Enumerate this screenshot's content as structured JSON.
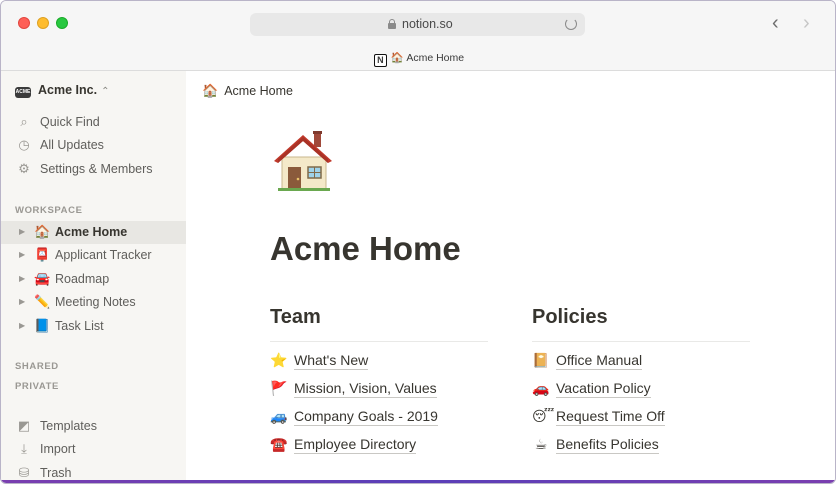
{
  "browser": {
    "url": "notion.so",
    "tab_title": "Acme Home",
    "tab_icon": "N",
    "tab_emoji": "🏠"
  },
  "sidebar": {
    "workspace_name": "Acme Inc.",
    "workspace_logo": "ACME",
    "workspace_chevron": "⌃",
    "top_items": [
      {
        "label": "Quick Find",
        "icon": "search-icon",
        "glyph": "⌕"
      },
      {
        "label": "All Updates",
        "icon": "clock-icon",
        "glyph": "◷"
      },
      {
        "label": "Settings & Members",
        "icon": "gear-icon",
        "glyph": "⚙"
      }
    ],
    "workspace_heading": "WORKSPACE",
    "pages": [
      {
        "label": "Acme Home",
        "emoji": "🏠",
        "active": true
      },
      {
        "label": "Applicant Tracker",
        "emoji": "📮",
        "active": false
      },
      {
        "label": "Roadmap",
        "emoji": "🚘",
        "active": false
      },
      {
        "label": "Meeting Notes",
        "emoji": "✏️",
        "active": false
      },
      {
        "label": "Task List",
        "emoji": "📘",
        "active": false
      }
    ],
    "shared_heading": "SHARED",
    "private_heading": "PRIVATE",
    "bottom_items": [
      {
        "label": "Templates",
        "icon": "templates-icon",
        "glyph": "◩"
      },
      {
        "label": "Import",
        "icon": "download-icon",
        "glyph": "⤓"
      },
      {
        "label": "Trash",
        "icon": "trash-icon",
        "glyph": "⛁"
      }
    ]
  },
  "main": {
    "breadcrumb": {
      "emoji": "🏠",
      "label": "Acme Home"
    },
    "page_icon": "house-icon",
    "title": "Acme Home",
    "columns": [
      {
        "title": "Team",
        "links": [
          {
            "emoji": "⭐",
            "label": "What's New"
          },
          {
            "emoji": "🚩",
            "label": "Mission, Vision, Values"
          },
          {
            "emoji": "🚙",
            "label": "Company Goals - 2019"
          },
          {
            "emoji": "☎️",
            "label": "Employee Directory"
          }
        ]
      },
      {
        "title": "Policies",
        "links": [
          {
            "emoji": "📔",
            "label": "Office Manual"
          },
          {
            "emoji": "🚗",
            "label": "Vacation Policy"
          },
          {
            "emoji": "😴",
            "label": "Request Time Off"
          },
          {
            "emoji": "☕",
            "label": "Benefits Policies"
          }
        ]
      }
    ]
  },
  "colors": {
    "sidebar_bg": "#f7f6f3",
    "text": "#37352f",
    "muted": "#9a9893",
    "active_bg": "#e8e7e3"
  }
}
